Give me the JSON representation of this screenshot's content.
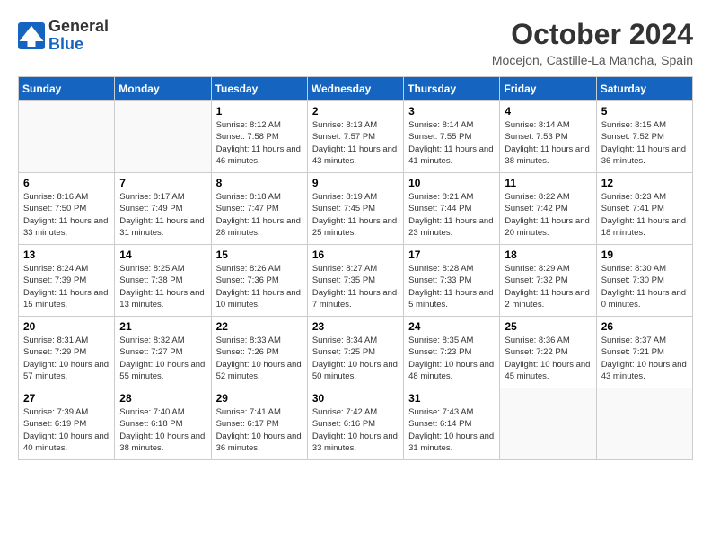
{
  "logo": {
    "general": "General",
    "blue": "Blue"
  },
  "title": "October 2024",
  "location": "Mocejon, Castille-La Mancha, Spain",
  "weekdays": [
    "Sunday",
    "Monday",
    "Tuesday",
    "Wednesday",
    "Thursday",
    "Friday",
    "Saturday"
  ],
  "weeks": [
    [
      {
        "day": "",
        "info": ""
      },
      {
        "day": "",
        "info": ""
      },
      {
        "day": "1",
        "info": "Sunrise: 8:12 AM\nSunset: 7:58 PM\nDaylight: 11 hours and 46 minutes."
      },
      {
        "day": "2",
        "info": "Sunrise: 8:13 AM\nSunset: 7:57 PM\nDaylight: 11 hours and 43 minutes."
      },
      {
        "day": "3",
        "info": "Sunrise: 8:14 AM\nSunset: 7:55 PM\nDaylight: 11 hours and 41 minutes."
      },
      {
        "day": "4",
        "info": "Sunrise: 8:14 AM\nSunset: 7:53 PM\nDaylight: 11 hours and 38 minutes."
      },
      {
        "day": "5",
        "info": "Sunrise: 8:15 AM\nSunset: 7:52 PM\nDaylight: 11 hours and 36 minutes."
      }
    ],
    [
      {
        "day": "6",
        "info": "Sunrise: 8:16 AM\nSunset: 7:50 PM\nDaylight: 11 hours and 33 minutes."
      },
      {
        "day": "7",
        "info": "Sunrise: 8:17 AM\nSunset: 7:49 PM\nDaylight: 11 hours and 31 minutes."
      },
      {
        "day": "8",
        "info": "Sunrise: 8:18 AM\nSunset: 7:47 PM\nDaylight: 11 hours and 28 minutes."
      },
      {
        "day": "9",
        "info": "Sunrise: 8:19 AM\nSunset: 7:45 PM\nDaylight: 11 hours and 25 minutes."
      },
      {
        "day": "10",
        "info": "Sunrise: 8:21 AM\nSunset: 7:44 PM\nDaylight: 11 hours and 23 minutes."
      },
      {
        "day": "11",
        "info": "Sunrise: 8:22 AM\nSunset: 7:42 PM\nDaylight: 11 hours and 20 minutes."
      },
      {
        "day": "12",
        "info": "Sunrise: 8:23 AM\nSunset: 7:41 PM\nDaylight: 11 hours and 18 minutes."
      }
    ],
    [
      {
        "day": "13",
        "info": "Sunrise: 8:24 AM\nSunset: 7:39 PM\nDaylight: 11 hours and 15 minutes."
      },
      {
        "day": "14",
        "info": "Sunrise: 8:25 AM\nSunset: 7:38 PM\nDaylight: 11 hours and 13 minutes."
      },
      {
        "day": "15",
        "info": "Sunrise: 8:26 AM\nSunset: 7:36 PM\nDaylight: 11 hours and 10 minutes."
      },
      {
        "day": "16",
        "info": "Sunrise: 8:27 AM\nSunset: 7:35 PM\nDaylight: 11 hours and 7 minutes."
      },
      {
        "day": "17",
        "info": "Sunrise: 8:28 AM\nSunset: 7:33 PM\nDaylight: 11 hours and 5 minutes."
      },
      {
        "day": "18",
        "info": "Sunrise: 8:29 AM\nSunset: 7:32 PM\nDaylight: 11 hours and 2 minutes."
      },
      {
        "day": "19",
        "info": "Sunrise: 8:30 AM\nSunset: 7:30 PM\nDaylight: 11 hours and 0 minutes."
      }
    ],
    [
      {
        "day": "20",
        "info": "Sunrise: 8:31 AM\nSunset: 7:29 PM\nDaylight: 10 hours and 57 minutes."
      },
      {
        "day": "21",
        "info": "Sunrise: 8:32 AM\nSunset: 7:27 PM\nDaylight: 10 hours and 55 minutes."
      },
      {
        "day": "22",
        "info": "Sunrise: 8:33 AM\nSunset: 7:26 PM\nDaylight: 10 hours and 52 minutes."
      },
      {
        "day": "23",
        "info": "Sunrise: 8:34 AM\nSunset: 7:25 PM\nDaylight: 10 hours and 50 minutes."
      },
      {
        "day": "24",
        "info": "Sunrise: 8:35 AM\nSunset: 7:23 PM\nDaylight: 10 hours and 48 minutes."
      },
      {
        "day": "25",
        "info": "Sunrise: 8:36 AM\nSunset: 7:22 PM\nDaylight: 10 hours and 45 minutes."
      },
      {
        "day": "26",
        "info": "Sunrise: 8:37 AM\nSunset: 7:21 PM\nDaylight: 10 hours and 43 minutes."
      }
    ],
    [
      {
        "day": "27",
        "info": "Sunrise: 7:39 AM\nSunset: 6:19 PM\nDaylight: 10 hours and 40 minutes."
      },
      {
        "day": "28",
        "info": "Sunrise: 7:40 AM\nSunset: 6:18 PM\nDaylight: 10 hours and 38 minutes."
      },
      {
        "day": "29",
        "info": "Sunrise: 7:41 AM\nSunset: 6:17 PM\nDaylight: 10 hours and 36 minutes."
      },
      {
        "day": "30",
        "info": "Sunrise: 7:42 AM\nSunset: 6:16 PM\nDaylight: 10 hours and 33 minutes."
      },
      {
        "day": "31",
        "info": "Sunrise: 7:43 AM\nSunset: 6:14 PM\nDaylight: 10 hours and 31 minutes."
      },
      {
        "day": "",
        "info": ""
      },
      {
        "day": "",
        "info": ""
      }
    ]
  ]
}
